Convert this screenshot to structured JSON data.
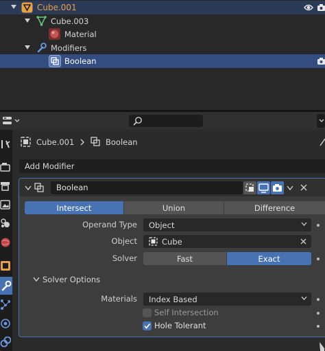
{
  "outliner": {
    "rows": [
      {
        "label": "Cube.001"
      },
      {
        "label": "Cube.003"
      },
      {
        "label": "Material"
      },
      {
        "label": "Modifiers"
      },
      {
        "label": "Boolean"
      }
    ]
  },
  "properties": {
    "search_placeholder": "",
    "breadcrumb": {
      "object": "Cube.001",
      "modifier": "Boolean"
    },
    "add_modifier": "Add Modifier",
    "modifier": {
      "name": "Boolean",
      "operations": [
        "Intersect",
        "Union",
        "Difference"
      ],
      "active_operation": "Intersect",
      "operand_type_label": "Operand Type",
      "operand_type_value": "Object",
      "object_label": "Object",
      "object_value": "Cube",
      "solver_label": "Solver",
      "solvers": [
        "Fast",
        "Exact"
      ],
      "active_solver": "Exact",
      "solver_options_label": "Solver Options",
      "materials_label": "Materials",
      "materials_value": "Index Based",
      "self_intersection_label": "Self Intersection",
      "self_intersection_checked": false,
      "hole_tolerant_label": "Hole Tolerant",
      "hole_tolerant_checked": true
    }
  },
  "colors": {
    "accent": "#4772b3",
    "selected_row": "#334d80",
    "panel": "#3d3d3d",
    "header": "#303030",
    "object_orange": "#e8a046",
    "mesh_green": "#66c27d"
  }
}
